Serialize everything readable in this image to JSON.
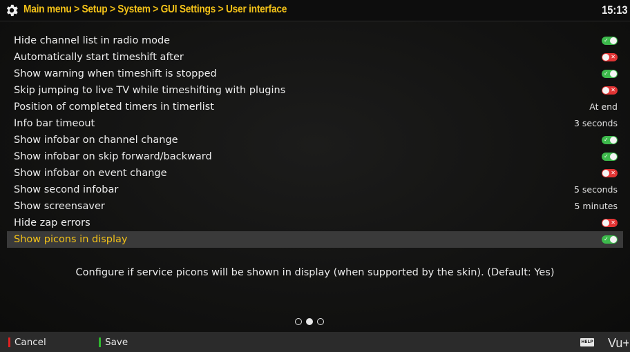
{
  "header": {
    "breadcrumb": "Main menu > Setup > System > GUI Settings > User interface",
    "clock": "15:13"
  },
  "settings": [
    {
      "label": "Hide channel list in radio mode",
      "type": "toggle",
      "on": true
    },
    {
      "label": "Automatically start timeshift after",
      "type": "toggle",
      "on": false
    },
    {
      "label": "Show warning when timeshift is stopped",
      "type": "toggle",
      "on": true
    },
    {
      "label": "Skip jumping to live TV while timeshifting with plugins",
      "type": "toggle",
      "on": false
    },
    {
      "label": "Position of completed timers in timerlist",
      "type": "value",
      "value": "At end"
    },
    {
      "label": "Info bar timeout",
      "type": "value",
      "value": "3 seconds"
    },
    {
      "label": "Show infobar on channel change",
      "type": "toggle",
      "on": true
    },
    {
      "label": "Show infobar on skip forward/backward",
      "type": "toggle",
      "on": true
    },
    {
      "label": "Show infobar on event change",
      "type": "toggle",
      "on": false
    },
    {
      "label": "Show second infobar",
      "type": "value",
      "value": "5 seconds"
    },
    {
      "label": "Show screensaver",
      "type": "value",
      "value": "5 minutes"
    },
    {
      "label": "Hide zap errors",
      "type": "toggle",
      "on": false
    },
    {
      "label": "Show picons in display",
      "type": "toggle",
      "on": true,
      "selected": true
    }
  ],
  "description": "Configure if service picons will be shown in display (when supported by the skin).  (Default: Yes)",
  "pager": {
    "pages": 3,
    "current": 2
  },
  "footer": {
    "cancel_label": "Cancel",
    "save_label": "Save",
    "help_label": "HELP",
    "logo": "Vu+"
  },
  "colors": {
    "accent": "#f2c118",
    "toggle_on": "#3dba4c",
    "toggle_off": "#e23434",
    "cancel": "#e02020",
    "save": "#2fb82f"
  },
  "icons": {
    "header": "gear-icon",
    "help": "help-icon"
  }
}
